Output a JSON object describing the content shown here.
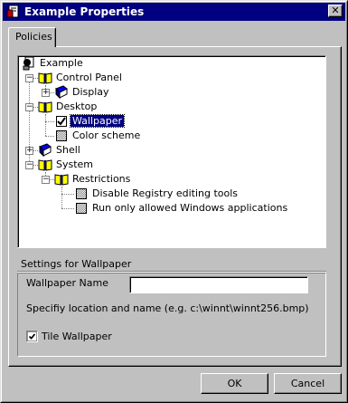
{
  "window": {
    "title": "Example Properties",
    "title_color": "#000080"
  },
  "tabs": [
    {
      "label": "Policies",
      "active": true
    }
  ],
  "tree": {
    "root": {
      "label": "Example",
      "icon": "computer-policy-icon"
    },
    "nodes": [
      {
        "id": "control_panel",
        "label": "Control Panel",
        "icon": "open-book-icon",
        "expanded": true
      },
      {
        "id": "display",
        "label": "Display",
        "icon": "closed-book-icon",
        "expanded": false
      },
      {
        "id": "desktop",
        "label": "Desktop",
        "icon": "open-book-icon",
        "expanded": true
      },
      {
        "id": "wallpaper",
        "label": "Wallpaper",
        "icon": "checked-box-icon",
        "selected": true
      },
      {
        "id": "color_scheme",
        "label": "Color scheme",
        "icon": "grayed-box-icon"
      },
      {
        "id": "shell",
        "label": "Shell",
        "icon": "closed-book-icon",
        "expanded": false
      },
      {
        "id": "system",
        "label": "System",
        "icon": "open-book-icon",
        "expanded": true
      },
      {
        "id": "restrictions",
        "label": "Restrictions",
        "icon": "open-book-icon",
        "expanded": true
      },
      {
        "id": "disable_registry",
        "label": "Disable Registry editing tools",
        "icon": "grayed-box-icon"
      },
      {
        "id": "run_only",
        "label": "Run only allowed Windows applications",
        "icon": "grayed-box-icon"
      }
    ]
  },
  "settings": {
    "heading": "Settings for Wallpaper",
    "wallpaper_name_label": "Wallpaper Name",
    "wallpaper_name_value": "",
    "hint": "Specifiy location and name (e.g.  c:\\winnt\\winnt256.bmp)",
    "tile_label": "Tile Wallpaper",
    "tile_checked": true
  },
  "buttons": {
    "ok": "OK",
    "cancel": "Cancel"
  }
}
